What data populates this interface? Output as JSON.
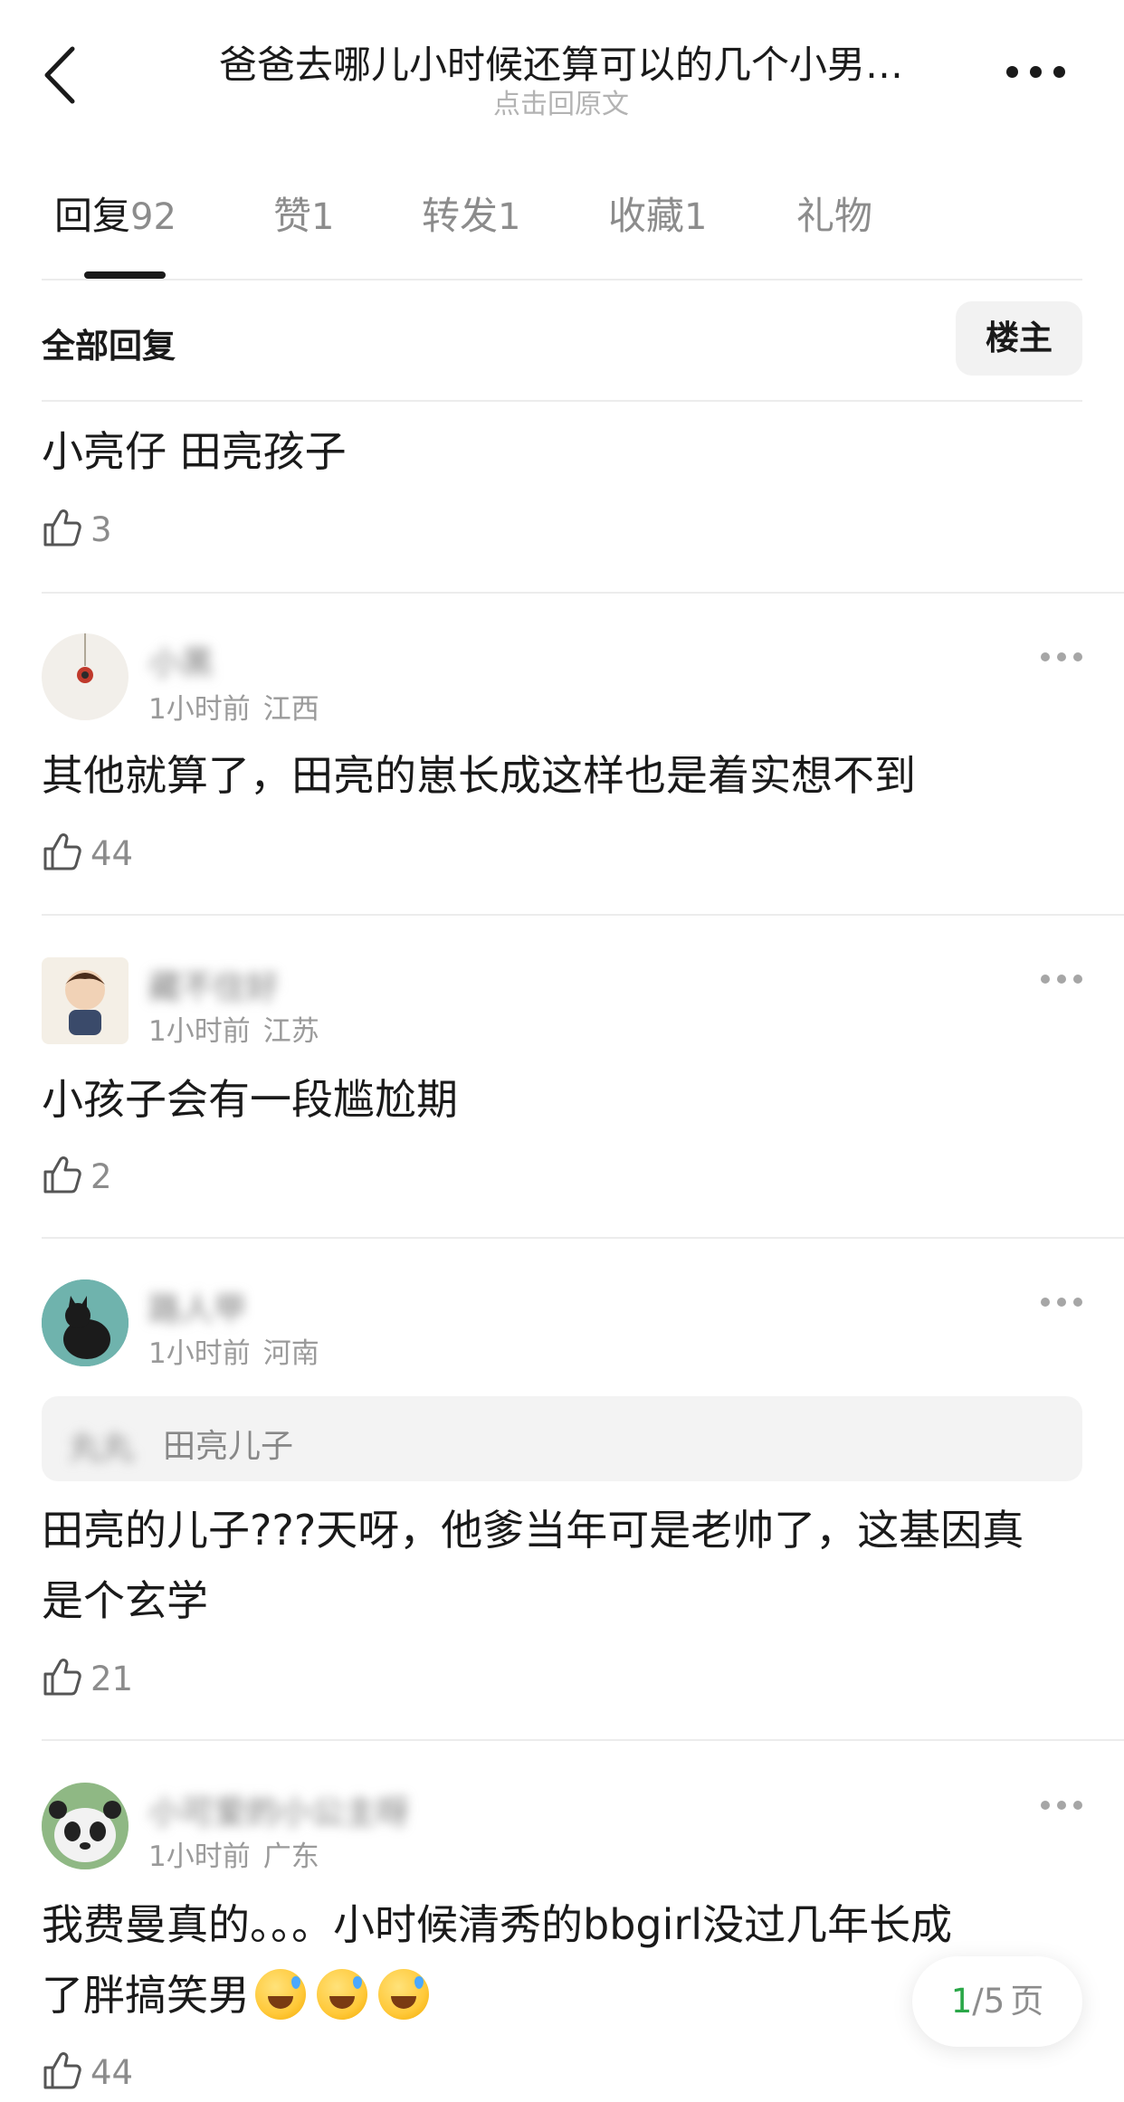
{
  "header": {
    "title": "爸爸去哪儿小时候还算可以的几个小男…",
    "subtitle": "点击回原文"
  },
  "tabs": [
    {
      "label": "回复",
      "count": "92"
    },
    {
      "label": "赞",
      "count": "1"
    },
    {
      "label": "转发",
      "count": "1"
    },
    {
      "label": "收藏",
      "count": "1"
    },
    {
      "label": "礼物",
      "count": ""
    }
  ],
  "filter": {
    "label": "全部回复",
    "op_button": "楼主"
  },
  "comments": [
    {
      "text": "小亮仔 田亮孩子",
      "likes": "3"
    },
    {
      "user": "小黑",
      "time": "1小时前",
      "location": "江西",
      "text": "其他就算了，田亮的崽长成这样也是着实想不到",
      "likes": "44"
    },
    {
      "user": "藏不住好",
      "time": "1小时前",
      "location": "江苏",
      "text": "小孩子会有一段尴尬期",
      "likes": "2"
    },
    {
      "user": "路人甲",
      "time": "1小时前",
      "location": "河南",
      "quote_user": "丸丸",
      "quote_text": "田亮儿子",
      "text_line1": "田亮的儿子???天呀，他爹当年可是老帅了，这基因真",
      "text_line2": "是个玄学",
      "likes": "21"
    },
    {
      "user": "小可爱的小公主呀",
      "time": "1小时前",
      "location": "广东",
      "text_line1": "我费曼真的。。。小时候清秀的bbgirl没过几年长成",
      "text_line2": "了胖搞笑男",
      "likes": "44"
    }
  ],
  "pager": {
    "current": "1",
    "total": "/5",
    "unit": "页"
  }
}
